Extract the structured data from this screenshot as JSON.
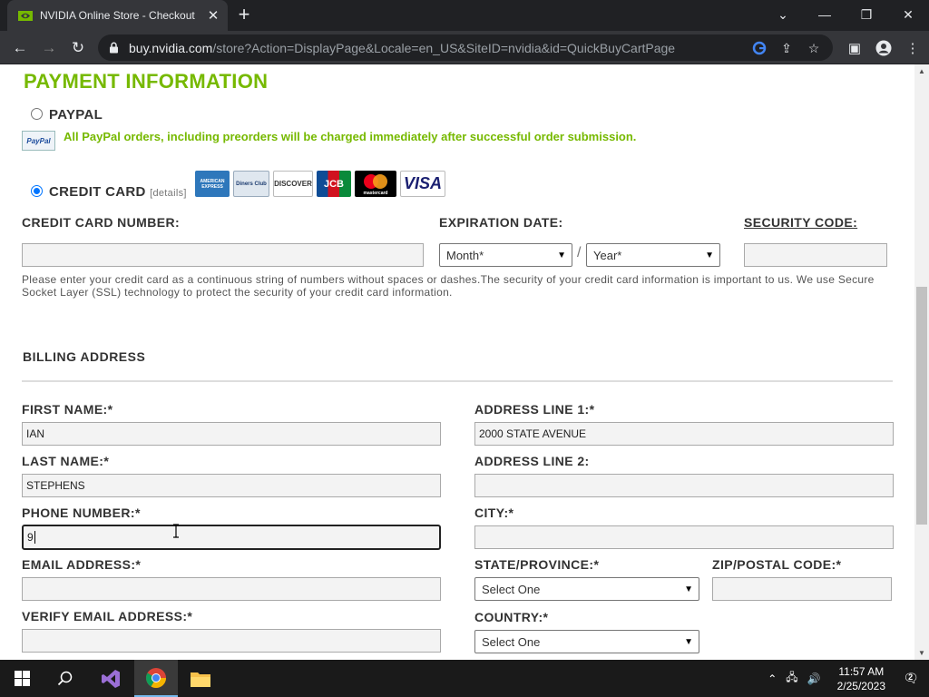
{
  "browser": {
    "tab_title": "NVIDIA Online Store - Checkout",
    "url_host": "buy.nvidia.com",
    "url_path": "/store?Action=DisplayPage&Locale=en_US&SiteID=nvidia&id=QuickBuyCartPage"
  },
  "payment": {
    "heading": "PAYMENT INFORMATION",
    "paypal_label": "PAYPAL",
    "paypal_logo_text": "PayPal",
    "paypal_note": "All PayPal orders, including preorders will be charged immediately after successful order submission.",
    "credit_label": "CREDIT CARD",
    "details_link": "details",
    "cards": [
      {
        "name": "AMERICAN EXPRESS",
        "color": "#2e77bb"
      },
      {
        "name": "Diners Club",
        "color": "#dfe7ef"
      },
      {
        "name": "DISCOVER",
        "color": "#ffffff"
      },
      {
        "name": "JCB",
        "color": "#0e4c96"
      },
      {
        "name": "mastercard",
        "color": "#000000"
      },
      {
        "name": "VISA",
        "color": "#ffffff"
      }
    ],
    "card_number_label": "CREDIT CARD NUMBER:",
    "card_number_value": "",
    "expiration_label": "EXPIRATION DATE:",
    "month_value": "Month*",
    "slash": "/",
    "year_value": "Year*",
    "security_label": "SECURITY CODE:",
    "security_value": "",
    "note": "Please enter your credit card as a continuous string of numbers without spaces or dashes.The security of your credit card information is important to us. We use Secure Socket Layer (SSL) technology to protect the security of your credit card information."
  },
  "billing": {
    "heading": "BILLING ADDRESS",
    "first_name_label": "FIRST NAME:*",
    "first_name_value": "IAN",
    "last_name_label": "LAST NAME:*",
    "last_name_value": "STEPHENS",
    "phone_label": "PHONE NUMBER:*",
    "phone_value": "9",
    "email_label": "EMAIL ADDRESS:*",
    "email_value": "",
    "verify_email_label": "VERIFY EMAIL ADDRESS:*",
    "verify_email_value": "",
    "address1_label": "ADDRESS LINE 1:*",
    "address1_value": "2000 STATE AVENUE",
    "address2_label": "ADDRESS LINE 2:",
    "address2_value": "",
    "city_label": "CITY:*",
    "city_value": "",
    "state_label": "STATE/PROVINCE:*",
    "state_value": "Select One",
    "zip_label": "ZIP/POSTAL CODE:*",
    "zip_value": "",
    "country_label": "COUNTRY:*",
    "country_value": "Select One"
  },
  "taskbar": {
    "time": "11:57 AM",
    "date": "2/25/2023",
    "notification_count": "2"
  },
  "colors": {
    "accent": "#76b900",
    "chrome_dark": "#202124",
    "chrome_toolbar": "#35363a"
  }
}
